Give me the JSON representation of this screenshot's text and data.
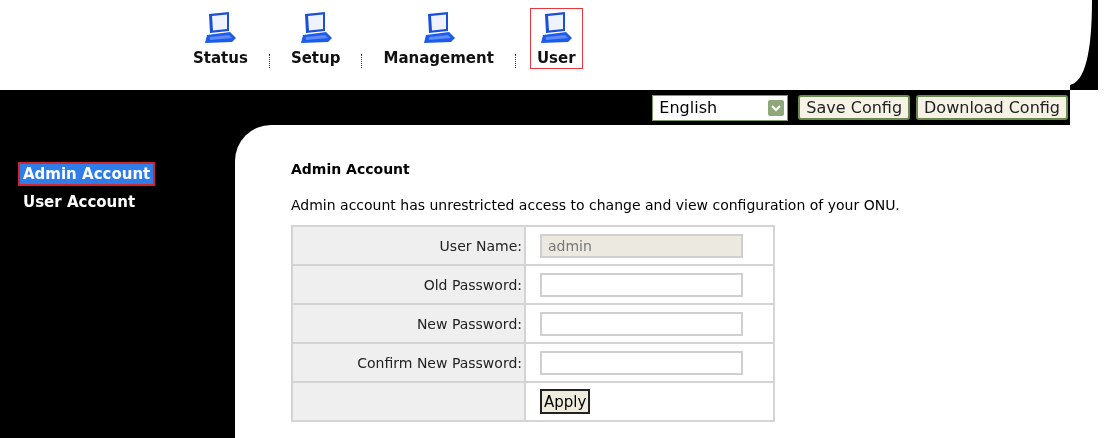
{
  "nav": [
    {
      "label": "Status",
      "selected": false
    },
    {
      "label": "Setup",
      "selected": false
    },
    {
      "label": "Management",
      "selected": false
    },
    {
      "label": "User",
      "selected": true
    }
  ],
  "language": {
    "value": "English"
  },
  "buttons": [
    "Save Config",
    "Download Config"
  ],
  "sidebar": {
    "items": [
      {
        "label": "Admin Account",
        "selected": true
      },
      {
        "label": "User Account",
        "selected": false
      }
    ]
  },
  "section": {
    "title": "Admin Account",
    "description": "Admin account has unrestricted access to change and view configuration of your ONU."
  },
  "form": {
    "rows": [
      {
        "kind": "field",
        "label": "User Name:",
        "value": "admin",
        "disabled": true
      },
      {
        "kind": "field",
        "label": "Old Password:",
        "value": "",
        "disabled": false
      },
      {
        "kind": "field",
        "label": "New Password:",
        "value": "",
        "disabled": false
      },
      {
        "kind": "field",
        "label": "Confirm New Password:",
        "value": "",
        "disabled": false
      },
      {
        "kind": "button",
        "button": "Apply"
      }
    ]
  }
}
